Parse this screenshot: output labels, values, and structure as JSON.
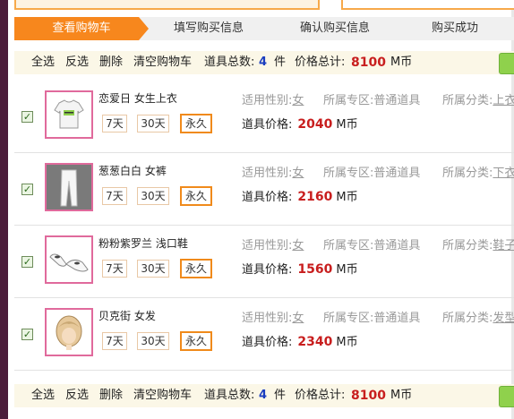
{
  "steps": [
    "查看购物车",
    "填写购买信息",
    "确认购买信息",
    "购买成功"
  ],
  "actions": {
    "select_all": "全选",
    "invert": "反选",
    "delete": "删除",
    "clear_cart": "清空购物车",
    "total_count_label": "道具总数:",
    "total_count": "4",
    "total_count_unit": "件",
    "total_price_label": "价格总计:",
    "total_price": "8100",
    "total_price_unit": "M币"
  },
  "labels": {
    "gender": "适用性别:",
    "zone": "所属专区:",
    "category": "所属分类:",
    "price": "道具价格:",
    "price_unit": "M币",
    "dur_7": "7天",
    "dur_30": "30天",
    "dur_perm": "永久"
  },
  "items": [
    {
      "name": "恋爱日 女生上衣",
      "gender": "女",
      "zone": "普通道具",
      "category": "上衣",
      "price": "2040",
      "checked": true
    },
    {
      "name": "葱葱白白 女裤",
      "gender": "女",
      "zone": "普通道具",
      "category": "下衣",
      "price": "2160",
      "checked": true
    },
    {
      "name": "粉粉紫罗兰 浅口鞋",
      "gender": "女",
      "zone": "普通道具",
      "category": "鞋子",
      "price": "1560",
      "checked": true
    },
    {
      "name": "贝克街 女发",
      "gender": "女",
      "zone": "普通道具",
      "category": "发型",
      "price": "2340",
      "checked": true
    }
  ],
  "colors": {
    "accent": "#f7871d",
    "price": "#c81e1e",
    "count": "#1a3dbf",
    "thumb_border": "#e06a9c"
  }
}
